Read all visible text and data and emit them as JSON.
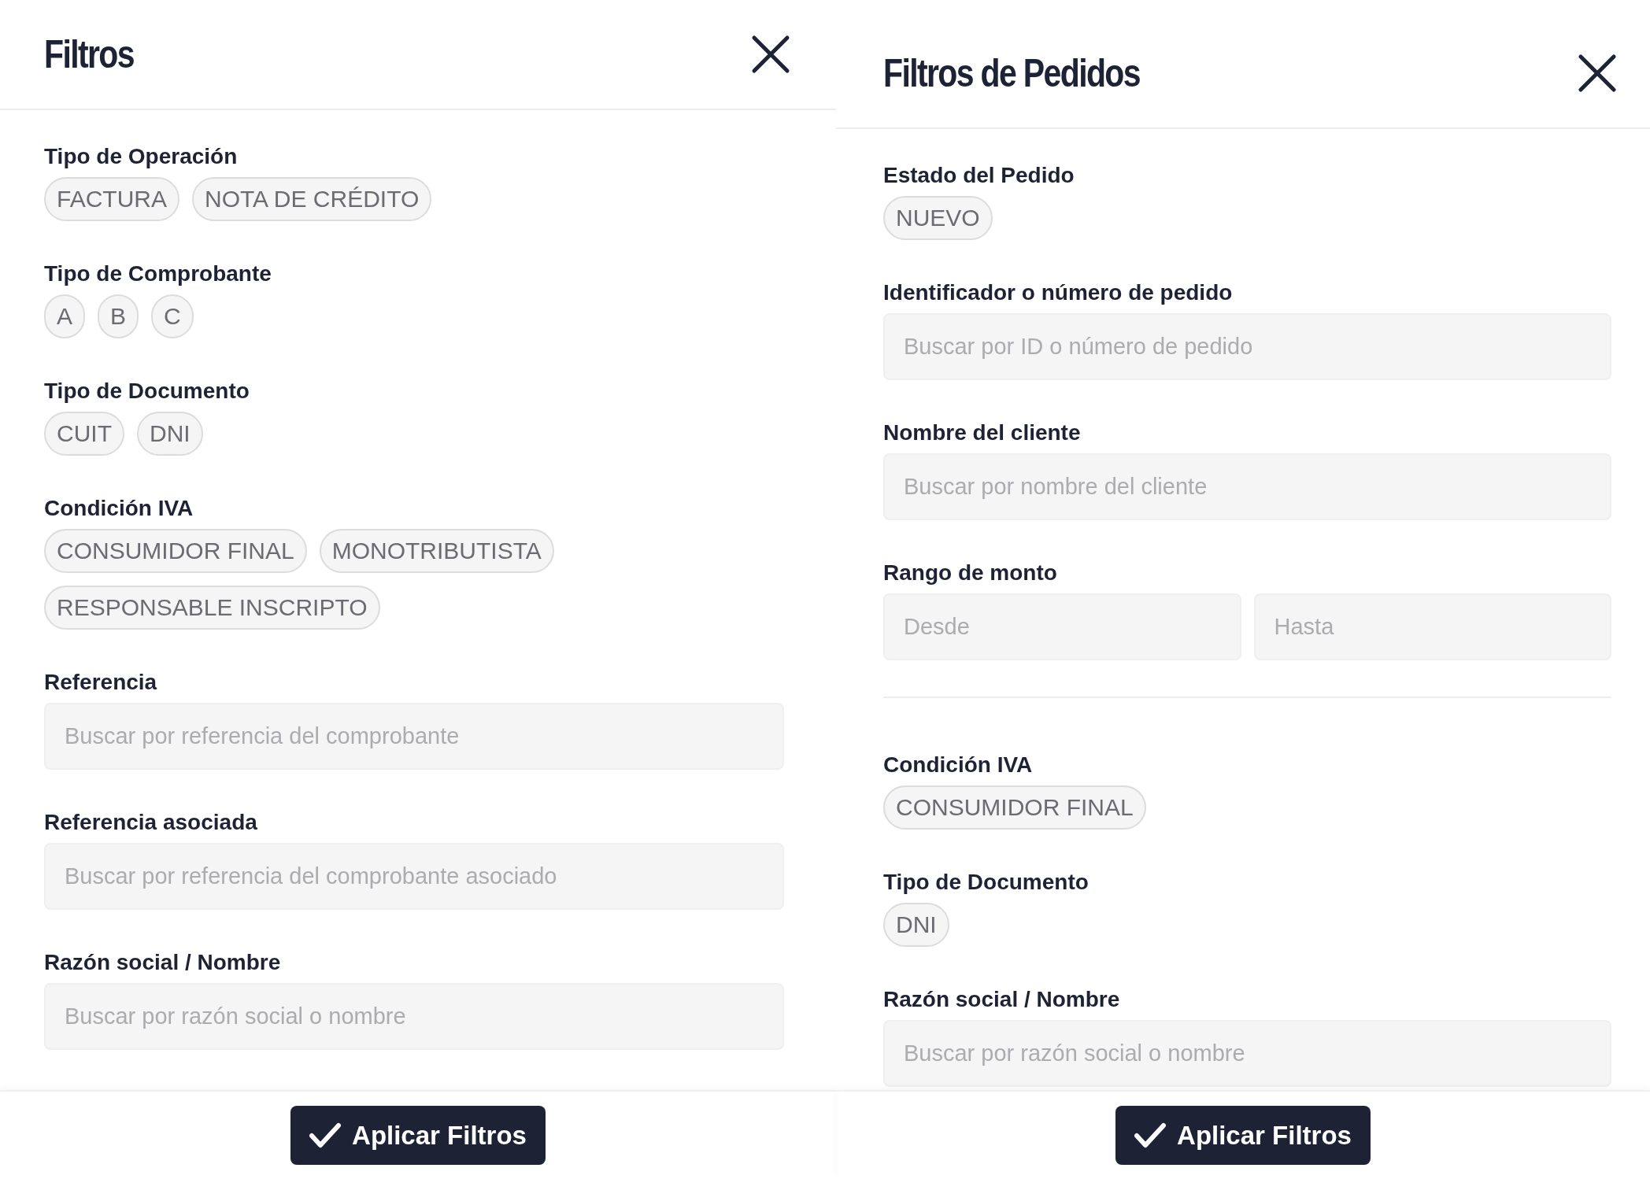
{
  "panels": [
    {
      "title": "Filtros",
      "sections": [
        {
          "kind": "chips",
          "label": "Tipo de Operación",
          "chips": [
            {
              "label": "FACTURA",
              "selected": false
            },
            {
              "label": "NOTA DE CRÉDITO",
              "selected": false
            }
          ]
        },
        {
          "kind": "chips",
          "label": "Tipo de Comprobante",
          "chips": [
            {
              "label": "A",
              "selected": false
            },
            {
              "label": "B",
              "selected": false
            },
            {
              "label": "C",
              "selected": false
            }
          ]
        },
        {
          "kind": "chips",
          "label": "Tipo de Documento",
          "chips": [
            {
              "label": "CUIT",
              "selected": false
            },
            {
              "label": "DNI",
              "selected": false
            }
          ]
        },
        {
          "kind": "chips",
          "label": "Condición IVA",
          "chips": [
            {
              "label": "CONSUMIDOR FINAL",
              "selected": false
            },
            {
              "label": "MONOTRIBUTISTA",
              "selected": false
            },
            {
              "label": "RESPONSABLE INSCRIPTO",
              "selected": false
            }
          ]
        },
        {
          "kind": "input",
          "label": "Referencia",
          "placeholder": "Buscar por referencia del comprobante"
        },
        {
          "kind": "input",
          "label": "Referencia asociada",
          "placeholder": "Buscar por referencia del comprobante asociado"
        },
        {
          "kind": "input",
          "label": "Razón social / Nombre",
          "placeholder": "Buscar por razón social o nombre"
        }
      ],
      "apply_button": "Aplicar Filtros"
    },
    {
      "title": "Filtros de Pedidos",
      "sections": [
        {
          "kind": "chips",
          "label": "Estado del Pedido",
          "chips": [
            {
              "label": "NUEVO",
              "selected": false
            }
          ]
        },
        {
          "kind": "input",
          "label": "Identificador o número de pedido",
          "placeholder": "Buscar por ID o número de pedido"
        },
        {
          "kind": "input",
          "label": "Nombre del cliente",
          "placeholder": "Buscar por nombre del cliente"
        },
        {
          "kind": "range",
          "label": "Rango de monto",
          "placeholders": [
            "Desde",
            "Hasta"
          ]
        },
        {
          "kind": "divider"
        },
        {
          "kind": "chips",
          "label": "Condición IVA",
          "chips": [
            {
              "label": "CONSUMIDOR FINAL",
              "selected": false
            }
          ]
        },
        {
          "kind": "chips",
          "label": "Tipo de Documento",
          "chips": [
            {
              "label": "DNI",
              "selected": false
            }
          ]
        },
        {
          "kind": "input",
          "label": "Razón social / Nombre",
          "placeholder": "Buscar por razón social o nombre"
        }
      ],
      "apply_button": "Aplicar Filtros"
    }
  ]
}
